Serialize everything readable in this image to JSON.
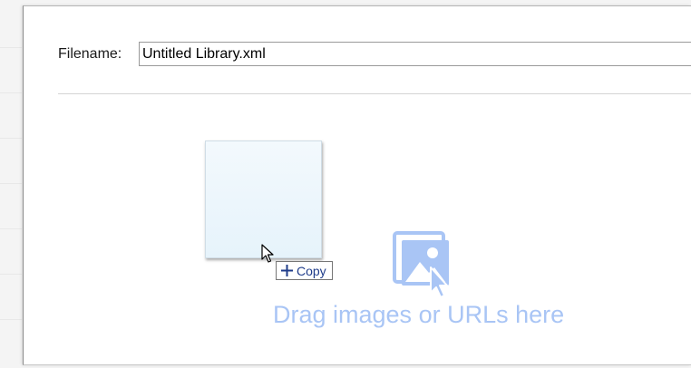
{
  "dialog": {
    "filename_label": "Filename:",
    "filename_value": "Untitled Library.xml"
  },
  "drop_zone": {
    "icon": "image-drop-icon",
    "text": "Drag images or URLs here",
    "text_color": "#a9c5f5"
  },
  "drag_feedback": {
    "cursor_icon": "arrow-cursor-icon",
    "tooltip_icon": "plus-icon",
    "tooltip_label": "Copy",
    "tooltip_color": "#1f3c8a"
  }
}
